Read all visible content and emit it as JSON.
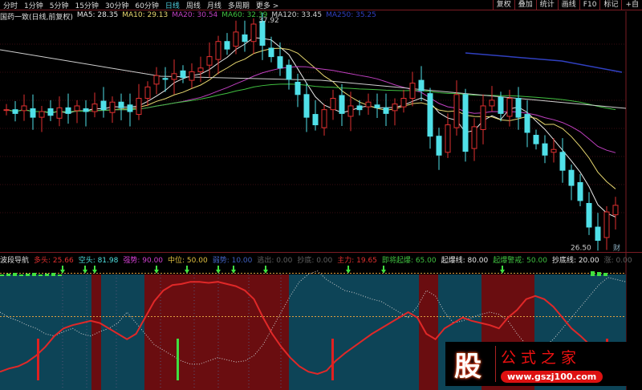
{
  "topbar": {
    "periods": [
      "分时",
      "1分钟",
      "5分钟",
      "15分钟",
      "30分钟",
      "60分钟",
      "日线",
      "周线",
      "月线",
      "多周期",
      "更多 >"
    ],
    "active": "日线",
    "tools": [
      "复权",
      "叠加",
      "统计",
      "画线",
      "F10",
      "标记",
      "+自"
    ]
  },
  "main": {
    "title": "国药一致(日线,前复权)",
    "ma": [
      {
        "label": "MA5: 28.35",
        "color": "#e8e8e8"
      },
      {
        "label": "MA10: 29.13",
        "color": "#e8d870"
      },
      {
        "label": "MA20: 30.54",
        "color": "#c040c0"
      },
      {
        "label": "MA60: 32.39",
        "color": "#40c040"
      },
      {
        "label": "MA120: 33.45",
        "color": "#d0d0d0"
      },
      {
        "label": "MA250: 35.25",
        "color": "#3040c0"
      }
    ],
    "high_label": "37.92",
    "low_label": "26.50",
    "fin_badge": "财"
  },
  "chart_data": {
    "type": "candlestick",
    "closes": [
      33.4,
      33.2,
      33.6,
      33.0,
      33.3,
      33.1,
      33.5,
      33.2,
      33.6,
      33.3,
      33.7,
      33.4,
      33.8,
      33.5,
      33.3,
      34.0,
      34.6,
      35.2,
      35.0,
      35.3,
      35.1,
      35.4,
      35.6,
      36.2,
      37.0,
      36.6,
      37.5,
      37.0,
      37.92,
      36.8,
      36.2,
      35.6,
      35.0,
      34.2,
      33.0,
      32.6,
      33.4,
      34.0,
      33.2,
      33.6,
      33.4,
      33.8,
      33.5,
      33.2,
      33.7,
      34.0,
      34.8,
      34.4,
      32.0,
      31.0,
      32.6,
      34.2,
      31.2,
      32.5,
      33.6,
      33.9,
      33.2,
      34.0,
      33.0,
      32.2,
      31.6,
      31.0,
      31.3,
      30.2,
      29.4,
      28.6,
      27.2,
      26.5,
      28.0,
      28.35
    ],
    "wave": {
      "red": [
        5,
        8,
        10,
        14,
        20,
        28,
        38,
        45,
        48,
        50,
        52,
        50,
        45,
        40,
        35,
        40,
        55,
        70,
        80,
        85,
        86,
        88,
        88,
        87,
        88,
        86,
        84,
        80,
        72,
        55,
        40,
        28,
        18,
        10,
        5,
        3,
        6,
        15,
        22,
        28,
        34,
        40,
        45,
        50,
        55,
        60,
        55,
        40,
        35,
        45,
        50,
        55,
        52,
        50,
        48,
        45,
        55,
        62,
        72,
        75,
        72,
        65,
        55,
        45,
        38,
        30,
        25,
        20,
        15,
        12
      ],
      "white": [
        60,
        55,
        52,
        48,
        45,
        40,
        38,
        42,
        45,
        40,
        38,
        42,
        45,
        50,
        60,
        50,
        40,
        30,
        25,
        20,
        15,
        12,
        12,
        15,
        18,
        16,
        14,
        15,
        20,
        30,
        45,
        60,
        75,
        88,
        95,
        98,
        90,
        85,
        80,
        78,
        75,
        72,
        70,
        65,
        60,
        55,
        65,
        80,
        75,
        60,
        50,
        52,
        55,
        58,
        60,
        58,
        52,
        40,
        30,
        25,
        28,
        35,
        45,
        55,
        65,
        75,
        85,
        92,
        90,
        88
      ]
    },
    "bands": [
      {
        "from": 0,
        "to": 19,
        "trend": "weak"
      },
      {
        "from": 19,
        "to": 21,
        "trend": "strong"
      },
      {
        "from": 21,
        "to": 30,
        "trend": "weak"
      },
      {
        "from": 30,
        "to": 60,
        "trend": "strong"
      },
      {
        "from": 60,
        "to": 87,
        "trend": "weak"
      },
      {
        "from": 87,
        "to": 91,
        "trend": "strong"
      },
      {
        "from": 91,
        "to": 100,
        "trend": "weak"
      },
      {
        "from": 100,
        "to": 111,
        "trend": "strong"
      },
      {
        "from": 111,
        "to": 130,
        "trend": "weak"
      }
    ]
  },
  "indicator": {
    "title": "波段导航",
    "items": [
      {
        "label": "多头: 25.66",
        "color": "#e03030"
      },
      {
        "label": "空头: 81.98",
        "color": "#50e0e0"
      },
      {
        "label": "强势: 90.00",
        "color": "#d040d0"
      },
      {
        "label": "中位: 50.00",
        "color": "#e0c040"
      },
      {
        "label": "弱势: 10.00",
        "color": "#4060c0"
      },
      {
        "label": "逃出: 0.00",
        "color": "#606060"
      },
      {
        "label": "抄底: 0.00",
        "color": "#606060"
      },
      {
        "label": "主力: 19.65",
        "color": "#e03030"
      },
      {
        "label": "即将起爆: 65.00",
        "color": "#40c040"
      },
      {
        "label": "起爆线: 80.00",
        "color": "#e8e8e8"
      },
      {
        "label": "起爆警戒: 50.00",
        "color": "#40c040"
      },
      {
        "label": "抄底线: 20.00",
        "color": "#e8e8e8"
      },
      {
        "label": "涨: 0.00",
        "color": "#606060"
      }
    ]
  },
  "colors": {
    "up": "#e03030",
    "down": "#50e0e8",
    "strong_band": "#6a0d10",
    "weak_band": "#0d4457",
    "grid": "#7a1c24"
  },
  "watermark": {
    "logo": "股",
    "name": "公式之家",
    "url": "www.gszj100.com"
  }
}
